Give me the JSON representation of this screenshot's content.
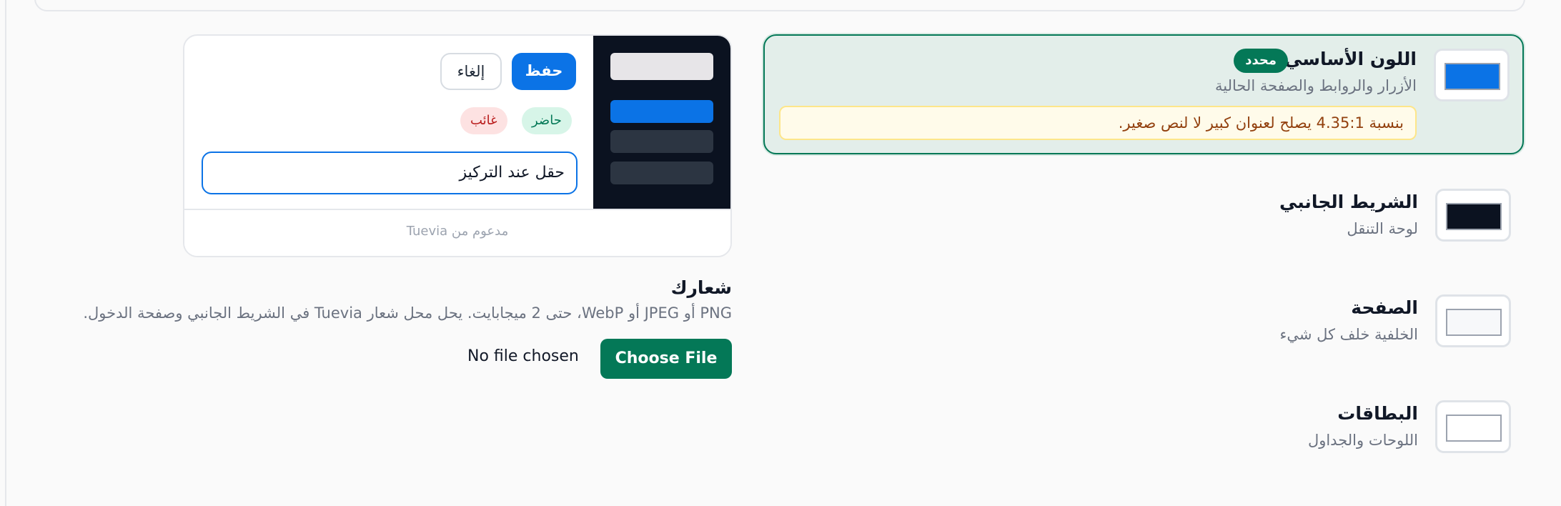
{
  "colors": {
    "accent": "#0b73e6",
    "success": "#047857",
    "sidebar": "#0b1220",
    "page": "#f7f8fa",
    "card": "#ffffff",
    "warning_bg": "#fffbea",
    "warning_text": "#92400e"
  },
  "color_roles": [
    {
      "title": "اللون الأساسي",
      "subtitle": "الأزرار والروابط والصفحة الحالية",
      "badge": "محدد",
      "swatch": "#0b73e6",
      "contrast_note": "بنسبة 4.35:1 يصلح لعنوان كبير لا لنص صغير."
    },
    {
      "title": "الشريط الجانبي",
      "subtitle": "لوحة التنقل",
      "swatch": "#0b1220"
    },
    {
      "title": "الصفحة",
      "subtitle": "الخلفية خلف كل شيء",
      "swatch": "#f7f8fa"
    },
    {
      "title": "البطاقات",
      "subtitle": "اللوحات والجداول",
      "swatch": "#ffffff"
    }
  ],
  "preview": {
    "save_label": "حفظ",
    "cancel_label": "إلغاء",
    "present_label": "حاضر",
    "absent_label": "غائب",
    "focused_input": "حقل عند التركيز",
    "footer": "مدعوم من Tuevia"
  },
  "logo": {
    "title": "شعارك",
    "help": "PNG أو JPEG أو WebP، حتى 2 ميجابايت. يحل محل شعار Tuevia في الشريط الجانبي وصفحة الدخول.",
    "choose_file_label": "Choose File",
    "file_status": "No file chosen"
  }
}
